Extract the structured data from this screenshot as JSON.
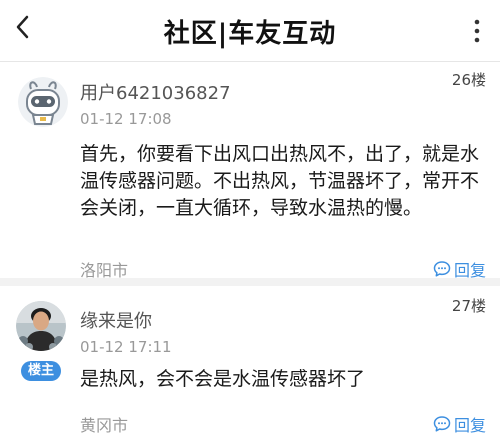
{
  "navbar": {
    "title": "社区|车友互动",
    "back_icon": "chevron-left-icon",
    "more_icon": "more-vertical-icon"
  },
  "posts": [
    {
      "username": "用户6421036827",
      "floor": "26楼",
      "time": "01-12 17:08",
      "content": "首先，你要看下出风口出热风不，出了，就是水温传感器问题。不出热风，节温器坏了，常开不会关闭，一直大循环，导致水温热的慢。",
      "location": "洛阳市",
      "reply_label": "回复",
      "avatar": "robot-avatar"
    },
    {
      "username": "缘来是你",
      "floor": "27楼",
      "time": "01-12 17:11",
      "content": "是热风，会不会是水温传感器坏了",
      "location": "黄冈市",
      "reply_label": "回复",
      "badge": "楼主",
      "avatar": "person-photo-avatar"
    }
  ],
  "colors": {
    "accent": "#3d8fe0",
    "muted": "#999999",
    "text": "#1a1a1a"
  }
}
